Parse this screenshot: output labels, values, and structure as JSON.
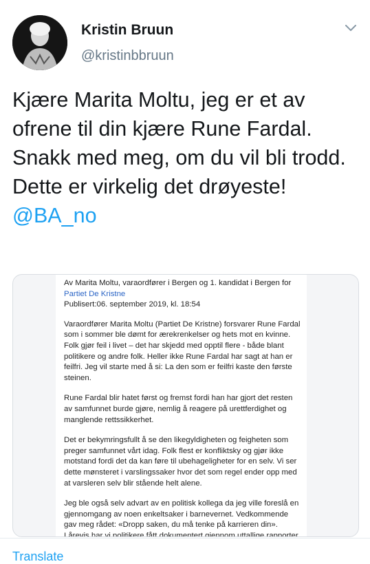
{
  "author": {
    "name": "Kristin Bruun",
    "handle": "@kristinbbruun",
    "avatar_icon": "profile-photo"
  },
  "tweet": {
    "text": "Kjære Marita Moltu, jeg er et av ofrene til din kjære Rune Fardal. Snakk med meg, om du vil bli trodd. Dette er virkelig det drøyeste!",
    "mention": "@BA_no"
  },
  "article": {
    "byline": "Av Marita Moltu, varaordfører i Bergen og 1. kandidat i Bergen for",
    "party": "Partiet De Kristne",
    "published": "Publisert:06. september 2019, kl. 18:54",
    "paragraphs": [
      "Varaordfører Marita Moltu (Partiet De Kristne) forsvarer Rune Fardal som i sommer ble dømt for ærekrenkelser og hets mot en kvinne. Folk gjør feil i livet – det har skjedd med opptil flere - både blant politikere og andre folk. Heller ikke Rune Fardal har sagt at han er feilfri. Jeg vil starte med å si: La den som er feilfri kaste den første steinen.",
      "Rune Fardal blir hatet først og fremst fordi han har gjort det resten av samfunnet burde gjøre, nemlig å reagere på urettferdighet og manglende rettssikkerhet.",
      "Det er bekymringsfullt å se den likegyldigheten og feigheten som preger samfunnet vårt idag. Folk flest er konfliktsky og gjør ikke motstand fordi det da kan føre til ubehageligheter for en selv. Vi ser dette mønsteret i varslingssaker hvor det som regel ender opp med at varsleren selv blir stående helt alene.",
      "Jeg ble også selv advart av en politisk kollega da jeg ville foreslå en gjennomgang av noen enkeltsaker i barnevernet. Vedkommende gav meg rådet: «Dropp saken, du må tenke på karrieren din».\nI årevis har vi politikere fått dokumentert gjennom uttallige rapporter og tilsyn, om alvorlig systemsvikt og om grove lovbrudd i barnevernssystemet. Hvem tar ansvar for det?"
    ]
  },
  "footer": {
    "translate_label": "Translate"
  }
}
